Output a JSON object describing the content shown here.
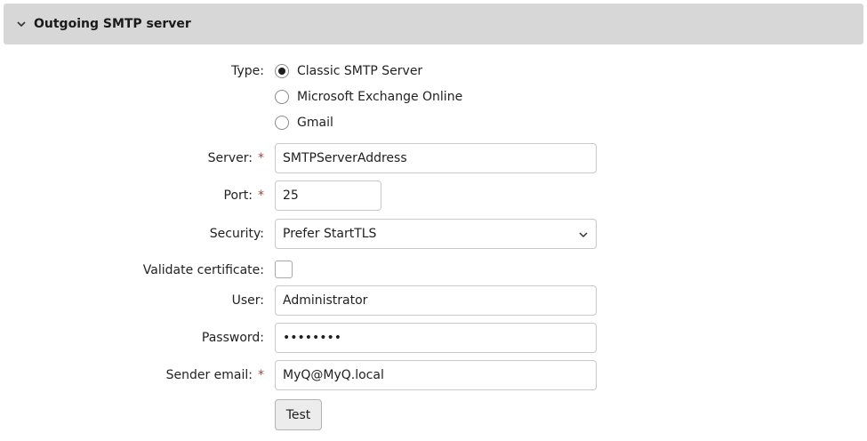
{
  "section": {
    "title": "Outgoing SMTP server",
    "expanded_icon": "chevron-down-icon"
  },
  "type": {
    "label": "Type:",
    "options": [
      "Classic SMTP Server",
      "Microsoft Exchange Online",
      "Gmail"
    ],
    "selected": "Classic SMTP Server"
  },
  "server": {
    "label": "Server:",
    "required": "*",
    "value": "SMTPServerAddress"
  },
  "port": {
    "label": "Port:",
    "required": "*",
    "value": "25"
  },
  "security": {
    "label": "Security:",
    "value": "Prefer StartTLS",
    "icon": "chevron-down-icon"
  },
  "validate": {
    "label": "Validate certificate:",
    "checked": false
  },
  "user": {
    "label": "User:",
    "value": "Administrator"
  },
  "password": {
    "label": "Password:",
    "value": "••••••••"
  },
  "sender": {
    "label": "Sender email:",
    "required": "*",
    "value": "MyQ@MyQ.local"
  },
  "test_button": {
    "label": "Test"
  }
}
